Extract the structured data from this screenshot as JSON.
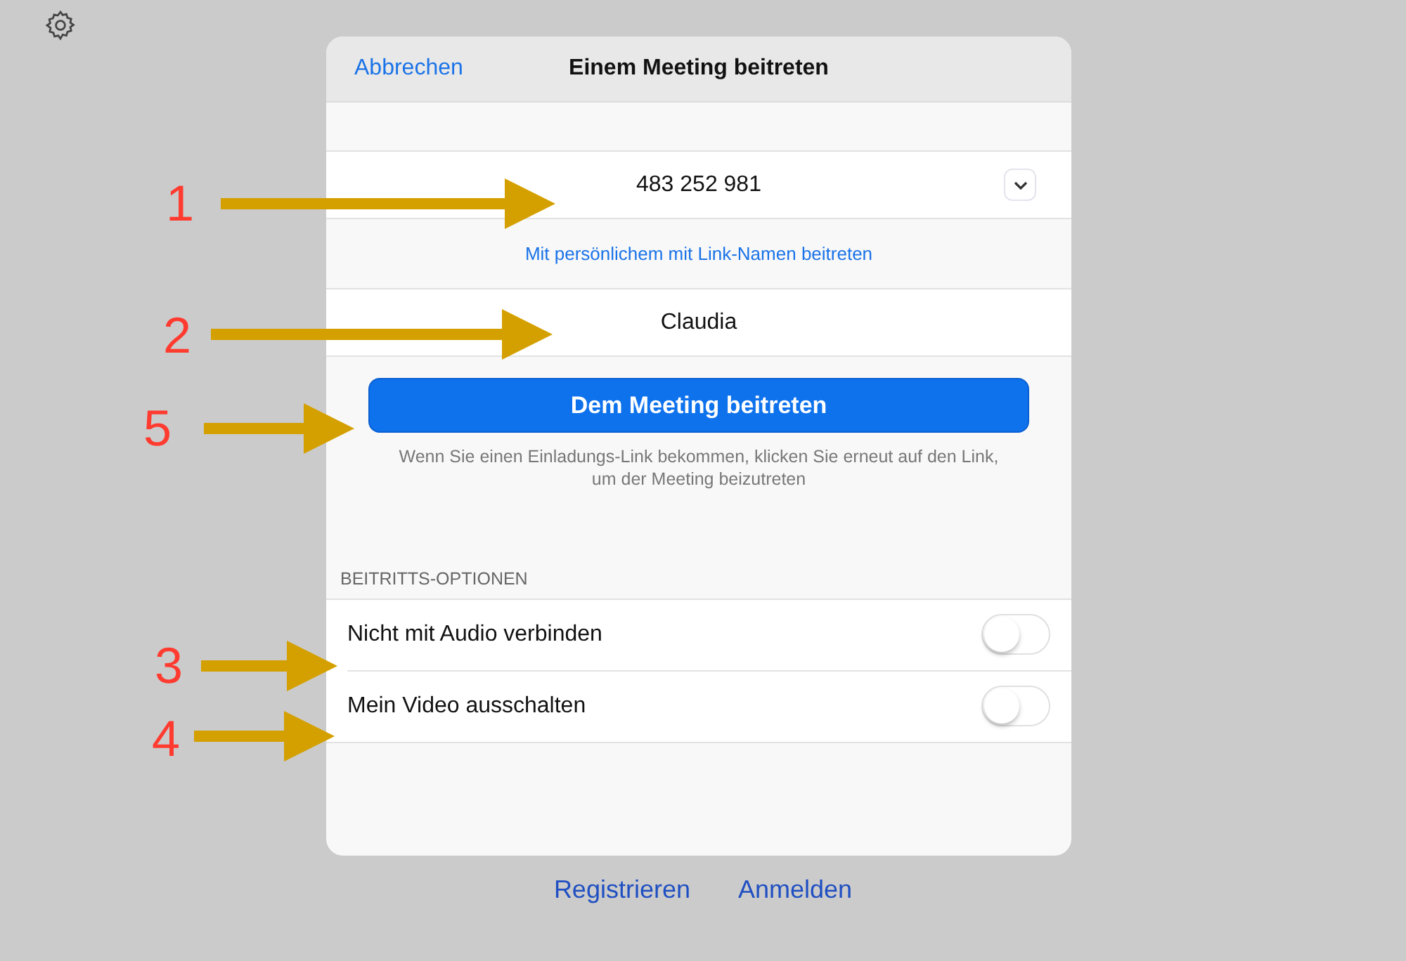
{
  "dialog": {
    "cancel": "Abbrechen",
    "title": "Einem Meeting beitreten"
  },
  "meeting_id": {
    "value": "483 252 981"
  },
  "personal_link": "Mit persönlichem mit Link-Namen beitreten",
  "name": {
    "value": "Claudia"
  },
  "join_button": "Dem Meeting beitreten",
  "help_text": "Wenn Sie einen Einladungs-Link bekommen, klicken Sie erneut auf den Link, um der Meeting beizutreten",
  "options_header": "BEITRITTS-OPTIONEN",
  "options": [
    {
      "label": "Nicht mit Audio verbinden",
      "on": false
    },
    {
      "label": "Mein Video ausschalten",
      "on": false
    }
  ],
  "footer": [
    "Registrieren",
    "Anmelden"
  ],
  "annotations": [
    {
      "label": "1"
    },
    {
      "label": "2"
    },
    {
      "label": "5"
    },
    {
      "label": "3"
    },
    {
      "label": "4"
    }
  ]
}
